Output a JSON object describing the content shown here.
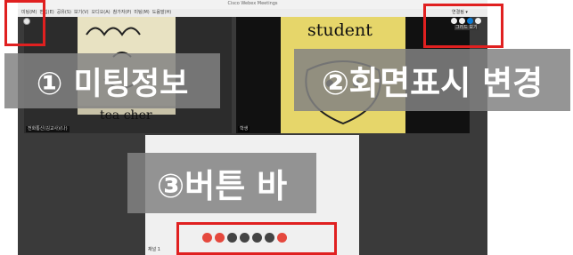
{
  "window": {
    "title": "Cisco Webex Meetings",
    "menus": [
      "미팅(M)",
      "편집(E)",
      "공유(S)",
      "보기(V)",
      "오디오(A)",
      "참가자(P)",
      "미팅(M)",
      "도움말(H)"
    ],
    "top_right_menu": "연결됨 ▾",
    "layout_label": "그리드 보기"
  },
  "videos": {
    "left": {
      "handwriting": "tea cher",
      "name": "전화통신(김교사)(나)"
    },
    "right": {
      "handwriting": "student",
      "name": "학생"
    }
  },
  "share": {
    "label": "채널 1"
  },
  "overlays": {
    "meeting_info": "① 미팅정보",
    "view_change": "②화면표시 변경",
    "button_bar": "③버튼 바"
  },
  "colors": {
    "highlight": "#e02020",
    "overlay_bg": "#828282",
    "accent": "#0a7bd6",
    "end": "#e5483d"
  },
  "icons": {
    "meeting_info": "info-icon",
    "control_bar": [
      "mute-icon",
      "video-icon",
      "share-icon",
      "participants-icon",
      "chat-icon",
      "more-icon",
      "leave-icon"
    ]
  }
}
